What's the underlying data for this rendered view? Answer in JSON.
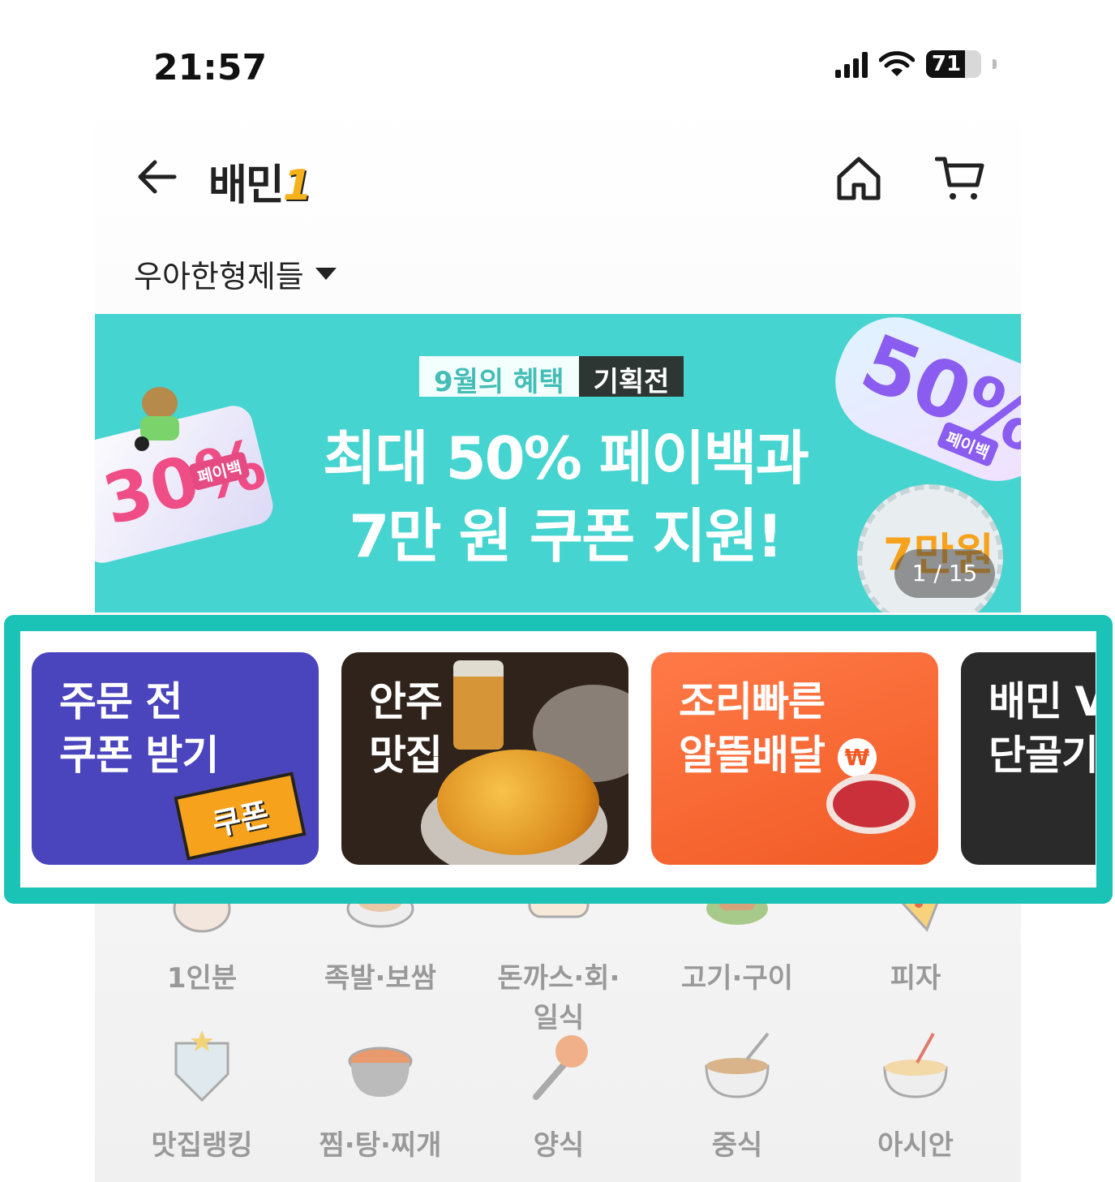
{
  "status_bar": {
    "time": "21:57",
    "battery": "71",
    "battery_level": 0.71
  },
  "header": {
    "logo_text": "배민",
    "logo_num": "1"
  },
  "store": {
    "name": "우아한형제들"
  },
  "banner": {
    "pill_left": "9월의 혜택",
    "pill_right": "기획전",
    "headline_line1": "최대 50% 페이백과",
    "headline_line2": "7만 원 쿠폰 지원!",
    "left_ticket_value": "30%",
    "left_ticket_tag": "페이백",
    "right_ticket_value": "50%",
    "right_ticket_tag": "페이백",
    "seal_value": "7만원",
    "counter": "1 / 15"
  },
  "cards": [
    {
      "line1": "주문 전",
      "line2": "쿠폰 받기",
      "sticker": "쿠폰"
    },
    {
      "line1": "안주",
      "line2": "맛집"
    },
    {
      "line1": "조리빠른",
      "line2": "알뜰배달"
    },
    {
      "line1": "배민 V",
      "line2": "단골기"
    }
  ],
  "categories": [
    {
      "label": "1인분",
      "icon": "single-serving-icon"
    },
    {
      "label": "족발·보쌈",
      "icon": "jokbal-icon"
    },
    {
      "label": "돈까스·회·일식",
      "icon": "sushi-icon"
    },
    {
      "label": "고기·구이",
      "icon": "grilled-meat-icon"
    },
    {
      "label": "피자",
      "icon": "pizza-icon"
    },
    {
      "label": "맛집랭킹",
      "icon": "ranking-badge-icon"
    },
    {
      "label": "찜·탕·찌개",
      "icon": "stew-pot-icon"
    },
    {
      "label": "양식",
      "icon": "pasta-fork-icon"
    },
    {
      "label": "중식",
      "icon": "noodle-bowl-icon"
    },
    {
      "label": "아시안",
      "icon": "asian-noodle-icon"
    }
  ],
  "colors": {
    "highlight_border": "#1bc2b6",
    "banner_bg": "#45d4cf"
  }
}
